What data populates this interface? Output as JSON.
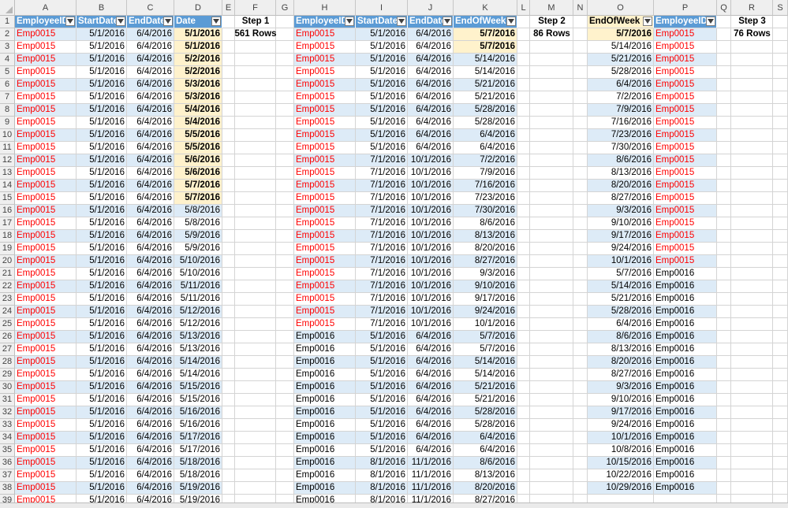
{
  "columns": [
    "A",
    "B",
    "C",
    "D",
    "E",
    "F",
    "G",
    "H",
    "I",
    "J",
    "K",
    "L",
    "M",
    "N",
    "O",
    "P",
    "Q",
    "R",
    "S"
  ],
  "rows": [
    1,
    2,
    3,
    4,
    5,
    6,
    7,
    8,
    9,
    10,
    11,
    12,
    13,
    14,
    15,
    16,
    17,
    18,
    19,
    20,
    21,
    22,
    23,
    24,
    25,
    26,
    27,
    28,
    29,
    30,
    31,
    32,
    33,
    34,
    35,
    36,
    37,
    38,
    39
  ],
  "steps": {
    "step1": {
      "title": "Step 1",
      "rows": "561 Rows"
    },
    "step2": {
      "title": "Step 2",
      "rows": "86 Rows"
    },
    "step3": {
      "title": "Step 3",
      "rows": "76 Rows"
    }
  },
  "table1": {
    "headers": [
      "EmployeeID",
      "StartDate",
      "EndDate",
      "Date"
    ],
    "rows": [
      [
        "Emp0015",
        "5/1/2016",
        "6/4/2016",
        "5/1/2016"
      ],
      [
        "Emp0015",
        "5/1/2016",
        "6/4/2016",
        "5/1/2016"
      ],
      [
        "Emp0015",
        "5/1/2016",
        "6/4/2016",
        "5/2/2016"
      ],
      [
        "Emp0015",
        "5/1/2016",
        "6/4/2016",
        "5/2/2016"
      ],
      [
        "Emp0015",
        "5/1/2016",
        "6/4/2016",
        "5/3/2016"
      ],
      [
        "Emp0015",
        "5/1/2016",
        "6/4/2016",
        "5/3/2016"
      ],
      [
        "Emp0015",
        "5/1/2016",
        "6/4/2016",
        "5/4/2016"
      ],
      [
        "Emp0015",
        "5/1/2016",
        "6/4/2016",
        "5/4/2016"
      ],
      [
        "Emp0015",
        "5/1/2016",
        "6/4/2016",
        "5/5/2016"
      ],
      [
        "Emp0015",
        "5/1/2016",
        "6/4/2016",
        "5/5/2016"
      ],
      [
        "Emp0015",
        "5/1/2016",
        "6/4/2016",
        "5/6/2016"
      ],
      [
        "Emp0015",
        "5/1/2016",
        "6/4/2016",
        "5/6/2016"
      ],
      [
        "Emp0015",
        "5/1/2016",
        "6/4/2016",
        "5/7/2016"
      ],
      [
        "Emp0015",
        "5/1/2016",
        "6/4/2016",
        "5/7/2016"
      ],
      [
        "Emp0015",
        "5/1/2016",
        "6/4/2016",
        "5/8/2016"
      ],
      [
        "Emp0015",
        "5/1/2016",
        "6/4/2016",
        "5/8/2016"
      ],
      [
        "Emp0015",
        "5/1/2016",
        "6/4/2016",
        "5/9/2016"
      ],
      [
        "Emp0015",
        "5/1/2016",
        "6/4/2016",
        "5/9/2016"
      ],
      [
        "Emp0015",
        "5/1/2016",
        "6/4/2016",
        "5/10/2016"
      ],
      [
        "Emp0015",
        "5/1/2016",
        "6/4/2016",
        "5/10/2016"
      ],
      [
        "Emp0015",
        "5/1/2016",
        "6/4/2016",
        "5/11/2016"
      ],
      [
        "Emp0015",
        "5/1/2016",
        "6/4/2016",
        "5/11/2016"
      ],
      [
        "Emp0015",
        "5/1/2016",
        "6/4/2016",
        "5/12/2016"
      ],
      [
        "Emp0015",
        "5/1/2016",
        "6/4/2016",
        "5/12/2016"
      ],
      [
        "Emp0015",
        "5/1/2016",
        "6/4/2016",
        "5/13/2016"
      ],
      [
        "Emp0015",
        "5/1/2016",
        "6/4/2016",
        "5/13/2016"
      ],
      [
        "Emp0015",
        "5/1/2016",
        "6/4/2016",
        "5/14/2016"
      ],
      [
        "Emp0015",
        "5/1/2016",
        "6/4/2016",
        "5/14/2016"
      ],
      [
        "Emp0015",
        "5/1/2016",
        "6/4/2016",
        "5/15/2016"
      ],
      [
        "Emp0015",
        "5/1/2016",
        "6/4/2016",
        "5/15/2016"
      ],
      [
        "Emp0015",
        "5/1/2016",
        "6/4/2016",
        "5/16/2016"
      ],
      [
        "Emp0015",
        "5/1/2016",
        "6/4/2016",
        "5/16/2016"
      ],
      [
        "Emp0015",
        "5/1/2016",
        "6/4/2016",
        "5/17/2016"
      ],
      [
        "Emp0015",
        "5/1/2016",
        "6/4/2016",
        "5/17/2016"
      ],
      [
        "Emp0015",
        "5/1/2016",
        "6/4/2016",
        "5/18/2016"
      ],
      [
        "Emp0015",
        "5/1/2016",
        "6/4/2016",
        "5/18/2016"
      ],
      [
        "Emp0015",
        "5/1/2016",
        "6/4/2016",
        "5/19/2016"
      ],
      [
        "Emp0015",
        "5/1/2016",
        "6/4/2016",
        "5/19/2016"
      ]
    ]
  },
  "table2": {
    "headers": [
      "EmployeeID",
      "StartDate",
      "EndDate",
      "EndOfWeek"
    ],
    "rows": [
      [
        "Emp0015",
        "5/1/2016",
        "6/4/2016",
        "5/7/2016"
      ],
      [
        "Emp0015",
        "5/1/2016",
        "6/4/2016",
        "5/7/2016"
      ],
      [
        "Emp0015",
        "5/1/2016",
        "6/4/2016",
        "5/14/2016"
      ],
      [
        "Emp0015",
        "5/1/2016",
        "6/4/2016",
        "5/14/2016"
      ],
      [
        "Emp0015",
        "5/1/2016",
        "6/4/2016",
        "5/21/2016"
      ],
      [
        "Emp0015",
        "5/1/2016",
        "6/4/2016",
        "5/21/2016"
      ],
      [
        "Emp0015",
        "5/1/2016",
        "6/4/2016",
        "5/28/2016"
      ],
      [
        "Emp0015",
        "5/1/2016",
        "6/4/2016",
        "5/28/2016"
      ],
      [
        "Emp0015",
        "5/1/2016",
        "6/4/2016",
        "6/4/2016"
      ],
      [
        "Emp0015",
        "5/1/2016",
        "6/4/2016",
        "6/4/2016"
      ],
      [
        "Emp0015",
        "7/1/2016",
        "10/1/2016",
        "7/2/2016"
      ],
      [
        "Emp0015",
        "7/1/2016",
        "10/1/2016",
        "7/9/2016"
      ],
      [
        "Emp0015",
        "7/1/2016",
        "10/1/2016",
        "7/16/2016"
      ],
      [
        "Emp0015",
        "7/1/2016",
        "10/1/2016",
        "7/23/2016"
      ],
      [
        "Emp0015",
        "7/1/2016",
        "10/1/2016",
        "7/30/2016"
      ],
      [
        "Emp0015",
        "7/1/2016",
        "10/1/2016",
        "8/6/2016"
      ],
      [
        "Emp0015",
        "7/1/2016",
        "10/1/2016",
        "8/13/2016"
      ],
      [
        "Emp0015",
        "7/1/2016",
        "10/1/2016",
        "8/20/2016"
      ],
      [
        "Emp0015",
        "7/1/2016",
        "10/1/2016",
        "8/27/2016"
      ],
      [
        "Emp0015",
        "7/1/2016",
        "10/1/2016",
        "9/3/2016"
      ],
      [
        "Emp0015",
        "7/1/2016",
        "10/1/2016",
        "9/10/2016"
      ],
      [
        "Emp0015",
        "7/1/2016",
        "10/1/2016",
        "9/17/2016"
      ],
      [
        "Emp0015",
        "7/1/2016",
        "10/1/2016",
        "9/24/2016"
      ],
      [
        "Emp0015",
        "7/1/2016",
        "10/1/2016",
        "10/1/2016"
      ],
      [
        "Emp0016",
        "5/1/2016",
        "6/4/2016",
        "5/7/2016"
      ],
      [
        "Emp0016",
        "5/1/2016",
        "6/4/2016",
        "5/7/2016"
      ],
      [
        "Emp0016",
        "5/1/2016",
        "6/4/2016",
        "5/14/2016"
      ],
      [
        "Emp0016",
        "5/1/2016",
        "6/4/2016",
        "5/14/2016"
      ],
      [
        "Emp0016",
        "5/1/2016",
        "6/4/2016",
        "5/21/2016"
      ],
      [
        "Emp0016",
        "5/1/2016",
        "6/4/2016",
        "5/21/2016"
      ],
      [
        "Emp0016",
        "5/1/2016",
        "6/4/2016",
        "5/28/2016"
      ],
      [
        "Emp0016",
        "5/1/2016",
        "6/4/2016",
        "5/28/2016"
      ],
      [
        "Emp0016",
        "5/1/2016",
        "6/4/2016",
        "6/4/2016"
      ],
      [
        "Emp0016",
        "5/1/2016",
        "6/4/2016",
        "6/4/2016"
      ],
      [
        "Emp0016",
        "8/1/2016",
        "11/1/2016",
        "8/6/2016"
      ],
      [
        "Emp0016",
        "8/1/2016",
        "11/1/2016",
        "8/13/2016"
      ],
      [
        "Emp0016",
        "8/1/2016",
        "11/1/2016",
        "8/20/2016"
      ],
      [
        "Emp0016",
        "8/1/2016",
        "11/1/2016",
        "8/27/2016"
      ]
    ]
  },
  "table3": {
    "headers": [
      "EndOfWeek",
      "EmployeeID"
    ],
    "rows": [
      [
        "5/7/2016",
        "Emp0015"
      ],
      [
        "5/14/2016",
        "Emp0015"
      ],
      [
        "5/21/2016",
        "Emp0015"
      ],
      [
        "5/28/2016",
        "Emp0015"
      ],
      [
        "6/4/2016",
        "Emp0015"
      ],
      [
        "7/2/2016",
        "Emp0015"
      ],
      [
        "7/9/2016",
        "Emp0015"
      ],
      [
        "7/16/2016",
        "Emp0015"
      ],
      [
        "7/23/2016",
        "Emp0015"
      ],
      [
        "7/30/2016",
        "Emp0015"
      ],
      [
        "8/6/2016",
        "Emp0015"
      ],
      [
        "8/13/2016",
        "Emp0015"
      ],
      [
        "8/20/2016",
        "Emp0015"
      ],
      [
        "8/27/2016",
        "Emp0015"
      ],
      [
        "9/3/2016",
        "Emp0015"
      ],
      [
        "9/10/2016",
        "Emp0015"
      ],
      [
        "9/17/2016",
        "Emp0015"
      ],
      [
        "9/24/2016",
        "Emp0015"
      ],
      [
        "10/1/2016",
        "Emp0015"
      ],
      [
        "5/7/2016",
        "Emp0016"
      ],
      [
        "5/14/2016",
        "Emp0016"
      ],
      [
        "5/21/2016",
        "Emp0016"
      ],
      [
        "5/28/2016",
        "Emp0016"
      ],
      [
        "6/4/2016",
        "Emp0016"
      ],
      [
        "8/6/2016",
        "Emp0016"
      ],
      [
        "8/13/2016",
        "Emp0016"
      ],
      [
        "8/20/2016",
        "Emp0016"
      ],
      [
        "8/27/2016",
        "Emp0016"
      ],
      [
        "9/3/2016",
        "Emp0016"
      ],
      [
        "9/10/2016",
        "Emp0016"
      ],
      [
        "9/17/2016",
        "Emp0016"
      ],
      [
        "9/24/2016",
        "Emp0016"
      ],
      [
        "10/1/2016",
        "Emp0016"
      ],
      [
        "10/8/2016",
        "Emp0016"
      ],
      [
        "10/15/2016",
        "Emp0016"
      ],
      [
        "10/22/2016",
        "Emp0016"
      ],
      [
        "10/29/2016",
        "Emp0016"
      ]
    ]
  },
  "colors": {
    "header_blue": "#5b9bd5",
    "band_blue": "#ddebf7",
    "highlight_yellow": "#fff2cc",
    "emp0015_red": "#ff0000"
  }
}
